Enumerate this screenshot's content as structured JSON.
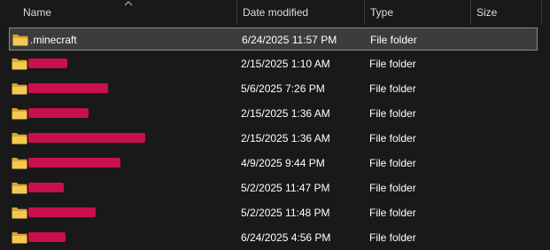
{
  "columns": {
    "name": "Name",
    "date_modified": "Date modified",
    "type": "Type",
    "size": "Size"
  },
  "rows": [
    {
      "name": ".minecraft",
      "date": "6/24/2025 11:57 PM",
      "type": "File folder",
      "size": "",
      "selected": true,
      "redacted": false
    },
    {
      "name": "",
      "date": "2/15/2025 1:10 AM",
      "type": "File folder",
      "size": "",
      "selected": false,
      "redacted": true
    },
    {
      "name": "",
      "date": "5/6/2025 7:26 PM",
      "type": "File folder",
      "size": "",
      "selected": false,
      "redacted": true
    },
    {
      "name": "",
      "date": "2/15/2025 1:36 AM",
      "type": "File folder",
      "size": "",
      "selected": false,
      "redacted": true
    },
    {
      "name": "",
      "date": "2/15/2025 1:36 AM",
      "type": "File folder",
      "size": "",
      "selected": false,
      "redacted": true
    },
    {
      "name": "",
      "date": "4/9/2025 9:44 PM",
      "type": "File folder",
      "size": "",
      "selected": false,
      "redacted": true
    },
    {
      "name": "",
      "date": "5/2/2025 11:47 PM",
      "type": "File folder",
      "size": "",
      "selected": false,
      "redacted": true
    },
    {
      "name": "",
      "date": "5/2/2025 11:48 PM",
      "type": "File folder",
      "size": "",
      "selected": false,
      "redacted": true
    },
    {
      "name": "",
      "date": "6/24/2025 4:56 PM",
      "type": "File folder",
      "size": "",
      "selected": false,
      "redacted": true
    }
  ],
  "icons": {
    "folder": "folder-icon",
    "sort": "sort-up-icon"
  },
  "colors": {
    "background": "#191919",
    "folder": "#f2c14e",
    "redaction": "#c8104a",
    "selection": "#3c3c3c"
  }
}
